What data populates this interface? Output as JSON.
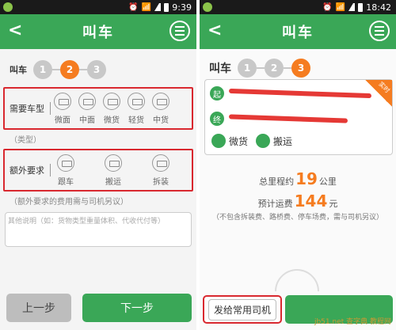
{
  "left": {
    "status_time": "9:39",
    "header_title": "叫车",
    "step_label": "叫车",
    "steps": [
      "1",
      "2",
      "3"
    ],
    "vehicle_label": "需要车型",
    "vehicles": [
      "微面",
      "中面",
      "微货",
      "轻货",
      "中货"
    ],
    "vehicle_note": "（类型）",
    "extra_label": "额外要求",
    "extras": [
      "跟车",
      "搬运",
      "拆装"
    ],
    "extra_note": "（额外要求的费用需与司机另议）",
    "other_placeholder": "其他说明（如：货物类型重量体积、代收代付等）",
    "prev_button": "上一步",
    "next_button": "下一步"
  },
  "right": {
    "status_time": "18:42",
    "header_title": "叫车",
    "step_label": "叫车",
    "steps": [
      "1",
      "2",
      "3"
    ],
    "start_pin": "起",
    "end_pin": "终",
    "badge": "实时",
    "tag_cargo": "微货",
    "tag_move": "搬运",
    "distance_prefix": "总里程约",
    "distance_value": "19",
    "distance_unit": "公里",
    "fare_prefix": "预计运费",
    "fare_value": "144",
    "fare_unit": "元",
    "fare_hint": "（不包含拆装费、路桥费、停车场费，需与司机另议）",
    "send_button": "发给常用司机"
  },
  "watermark": "jb51.net 查字典 教程网"
}
